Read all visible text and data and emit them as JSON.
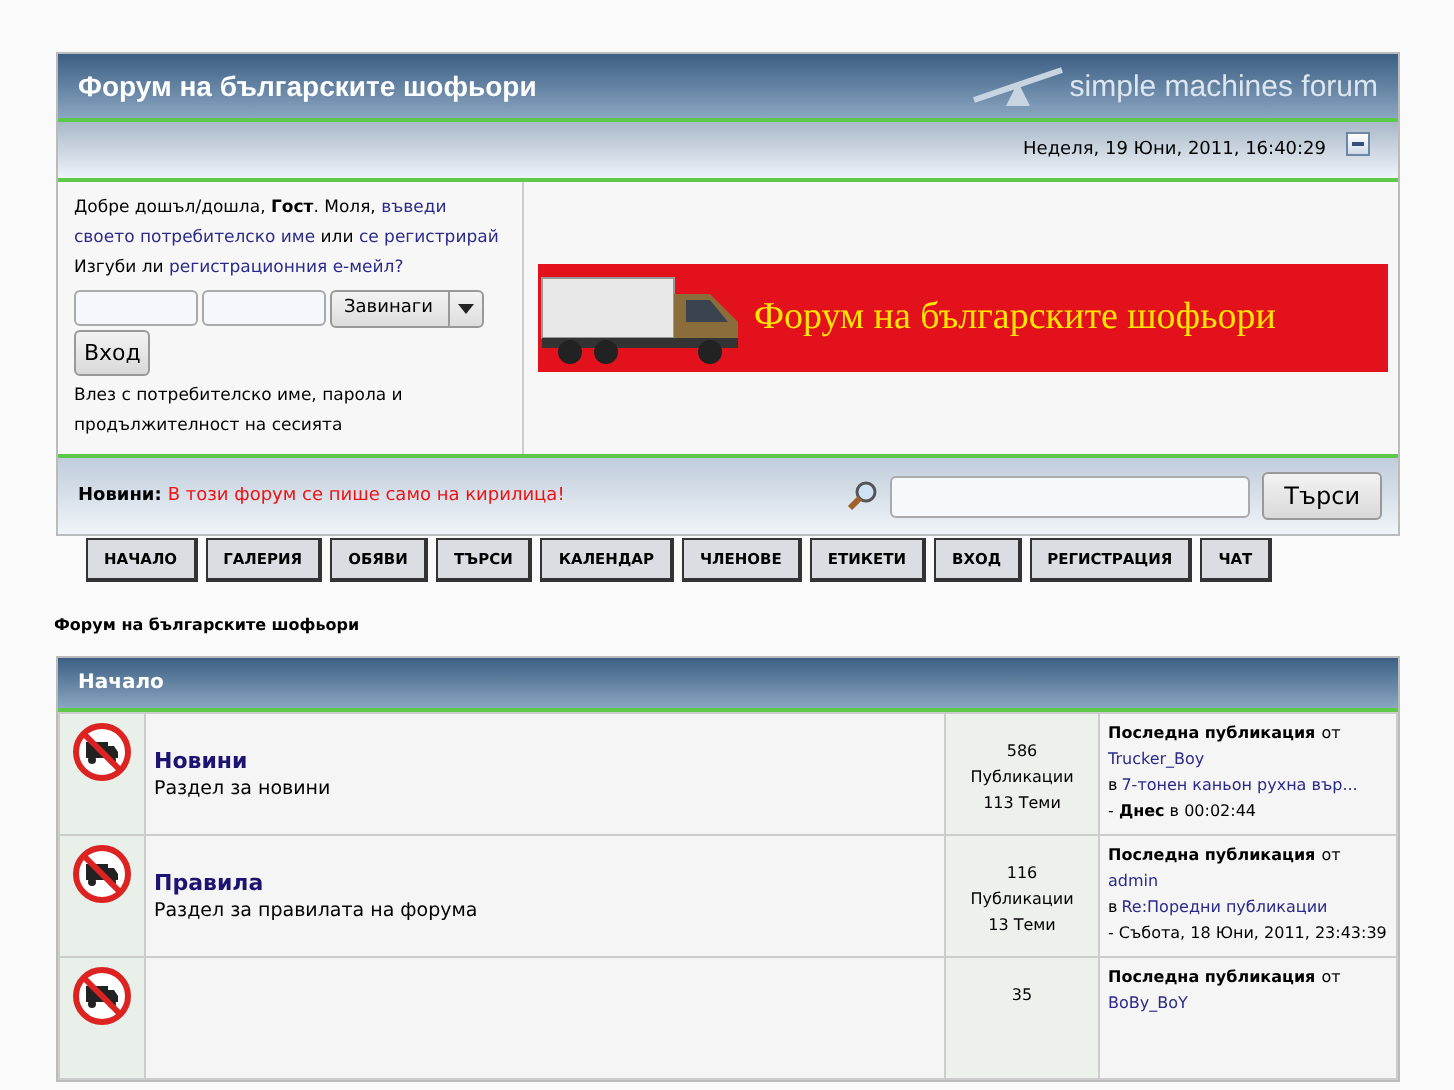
{
  "header": {
    "title": "Форум на българските шофьори",
    "logo_text": "simple machines forum"
  },
  "date_bar": {
    "datetime": "Неделя, 19 Юни, 2011, 16:40:29"
  },
  "user_box": {
    "greeting": "Добре дошъл/дошла, **Гост**. Моля, ",
    "login_link": [
      "въведи",
      "своето потребителско име"
    ],
    "or": " или ",
    "register_link": "се регистрирай",
    "lost_prefix": "Изгуби ли ",
    "lost_link": "регистрационния е-мейл?",
    "session_select": "Завинаги",
    "login_button": "Вход",
    "hint": "Влез с потребителско име, парола и продължителност на сесията"
  },
  "banner": {
    "text": "Форум на българските шофьори"
  },
  "news_bar": {
    "label": "Новини:",
    "text": "В този форум се пише само на кирилица!",
    "search_button": "Търси"
  },
  "tabs": [
    {
      "label": "НАЧАЛО",
      "selected": false
    },
    {
      "label": "ГАЛЕРИЯ",
      "selected": false
    },
    {
      "label": "ОБЯВИ",
      "selected": false
    },
    {
      "label": "ТЪРСИ",
      "selected": false
    },
    {
      "label": "КАЛЕНДАР",
      "selected": false
    },
    {
      "label": "ЧЛЕНОВЕ",
      "selected": false
    },
    {
      "label": "ЕТИКЕТИ",
      "selected": false
    },
    {
      "label": "ВХОД",
      "selected": false
    },
    {
      "label": "РЕГИСТРАЦИЯ",
      "selected": false
    },
    {
      "label": "ЧАТ",
      "selected": false
    }
  ],
  "breadcrumb": "Форум на българските шофьори",
  "category": {
    "title": "Начало",
    "boards": [
      {
        "name": "Новини",
        "description": "Раздел за новини",
        "posts": "586",
        "posts_label": "Публикации",
        "topics": "113 Теми",
        "last_label": "Последна публикация",
        "by": "от",
        "user": "Trucker_Boy",
        "in": "в",
        "topic": "7-тонен каньон рухна вър...",
        "time": "- **Днес** в 00:02:44"
      },
      {
        "name": "Правила",
        "description": "Раздел за правилата на форума",
        "posts": "116",
        "posts_label": "Публикации",
        "topics": "13 Теми",
        "last_label": "Последна публикация",
        "by": "от",
        "user": "admin",
        "in": "в",
        "topic": "Re:Поредни публикации",
        "time": "- Събота, 18 Юни, 2011, 23:43:39"
      },
      {
        "posts": "35",
        "last_label": "Последна публикация",
        "by": "от",
        "user": "BoBy_BoY"
      }
    ]
  }
}
